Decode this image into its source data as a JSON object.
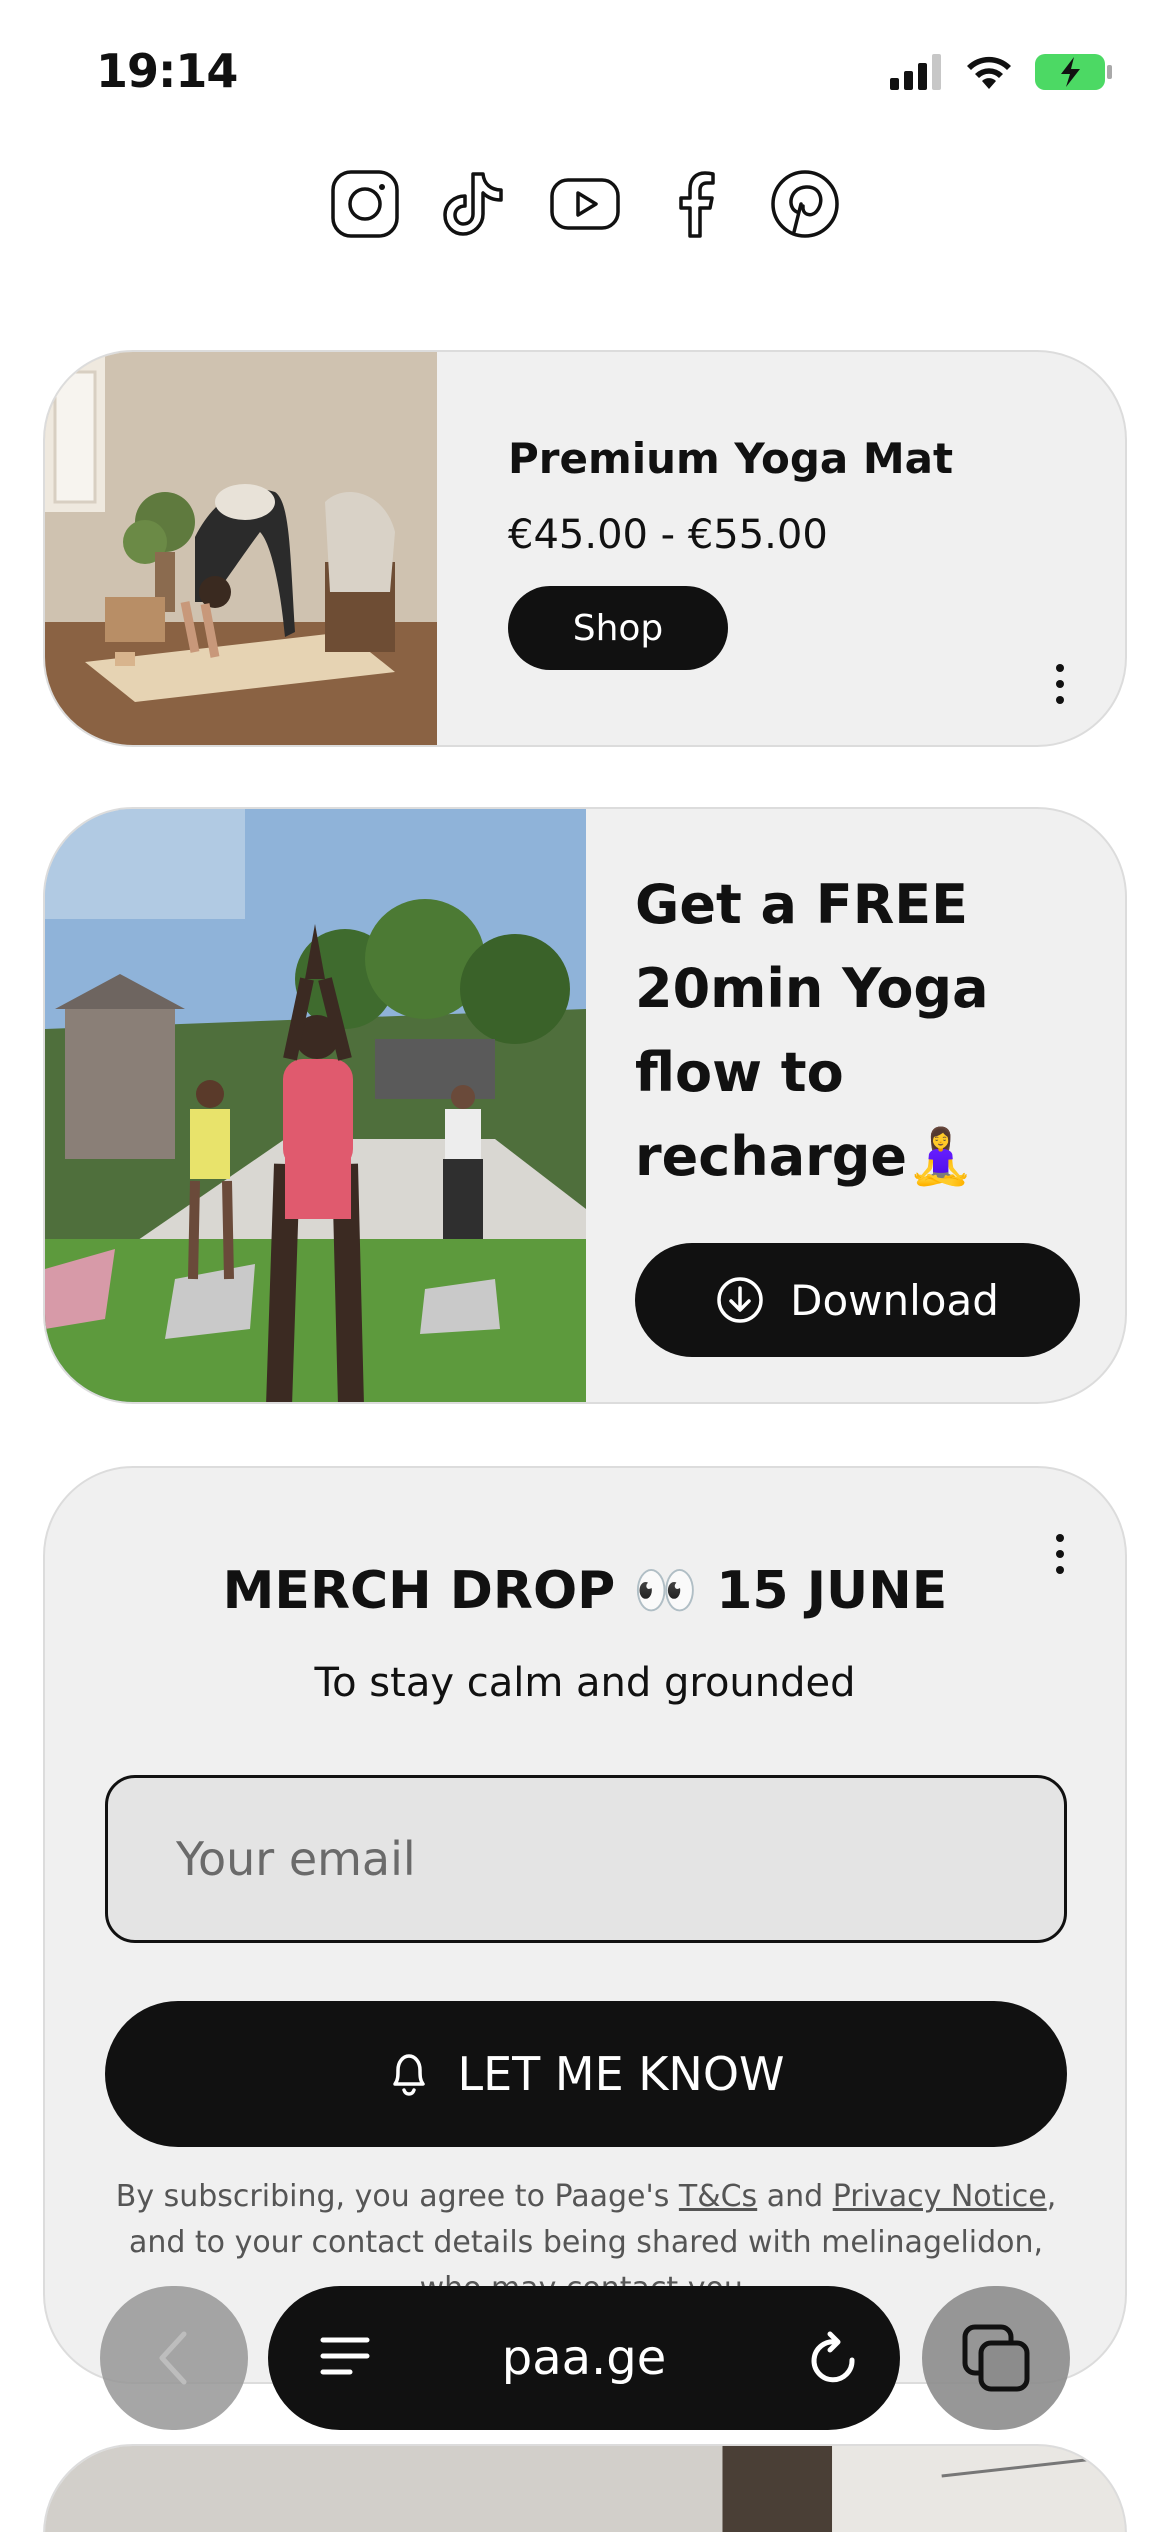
{
  "status_bar": {
    "time": "19:14",
    "icons": [
      "cellular-signal-icon",
      "wifi-icon",
      "battery-charging-icon"
    ],
    "battery_color": "#4cd964"
  },
  "socials": [
    "instagram-icon",
    "tiktok-icon",
    "youtube-icon",
    "facebook-icon",
    "pinterest-icon"
  ],
  "product_card": {
    "title": "Premium Yoga Mat",
    "price": "€45.00 - €55.00",
    "button_label": "Shop"
  },
  "freebie_card": {
    "title": "Get a FREE 20min Yoga flow to recharge🧘‍♀️",
    "button_label": "Download"
  },
  "signup_card": {
    "heading": "MERCH DROP 👀 15 JUNE",
    "subheading": "To stay calm and grounded",
    "email_placeholder": "Your email",
    "button_label": "LET ME KNOW",
    "legal_prefix": "By subscribing, you agree to Paage's ",
    "terms_link": "T&Cs",
    "legal_and": " and ",
    "privacy_link": "Privacy Notice",
    "legal_suffix": ", and to your contact details being shared with melinagelidon, who may contact you."
  },
  "browser": {
    "url": "paa.ge"
  },
  "colors": {
    "card_background": "#f0f0f0",
    "button_background": "#111111",
    "page_background": "#ffffff"
  }
}
